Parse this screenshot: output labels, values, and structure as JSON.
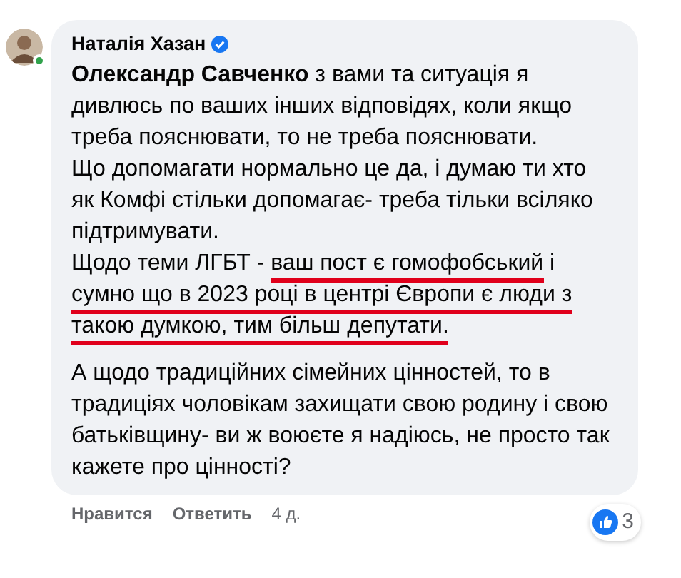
{
  "comment": {
    "author": "Наталія Хазан",
    "verified": true,
    "online": true,
    "paragraphs": [
      {
        "lines": [
          {
            "segments": [
              {
                "text": "**Олександр Савченко** з вами та ситуація я дивлюсь по ваших інших відповідях, коли якщо треба пояснювати, то не треба пояснювати.",
                "underlined": false
              }
            ]
          },
          {
            "segments": [
              {
                "text": "Що допомагати нормально це да, і думаю ти хто як Комфі стільки допомагає- треба тільки всіляко підтримувати.",
                "underlined": false
              }
            ]
          },
          {
            "segments": [
              {
                "text": "Щодо теми ЛГБТ - ",
                "underlined": false
              },
              {
                "text": "ваш пост є гомофобський",
                "underlined": true
              },
              {
                "text": " і ",
                "underlined": false
              },
              {
                "text": "сумно що в 2023 році в центрі Європи є люди з такою думкою, тим більш депутати.",
                "underlined": true
              }
            ]
          }
        ]
      },
      {
        "lines": [
          {
            "segments": [
              {
                "text": "А щодо традиційних сімейних цінностей, то в традиціях чоловікам захищати свою родину і свою батьківщину- ви ж воюєте я надіюсь, не просто так кажете про цінності?",
                "underlined": false
              }
            ]
          }
        ]
      }
    ],
    "reactions": {
      "count": "3"
    },
    "actions": [
      {
        "kind": "link",
        "label": "Нравится"
      },
      {
        "kind": "link",
        "label": "Ответить"
      },
      {
        "kind": "time",
        "label": "4 д."
      }
    ]
  }
}
